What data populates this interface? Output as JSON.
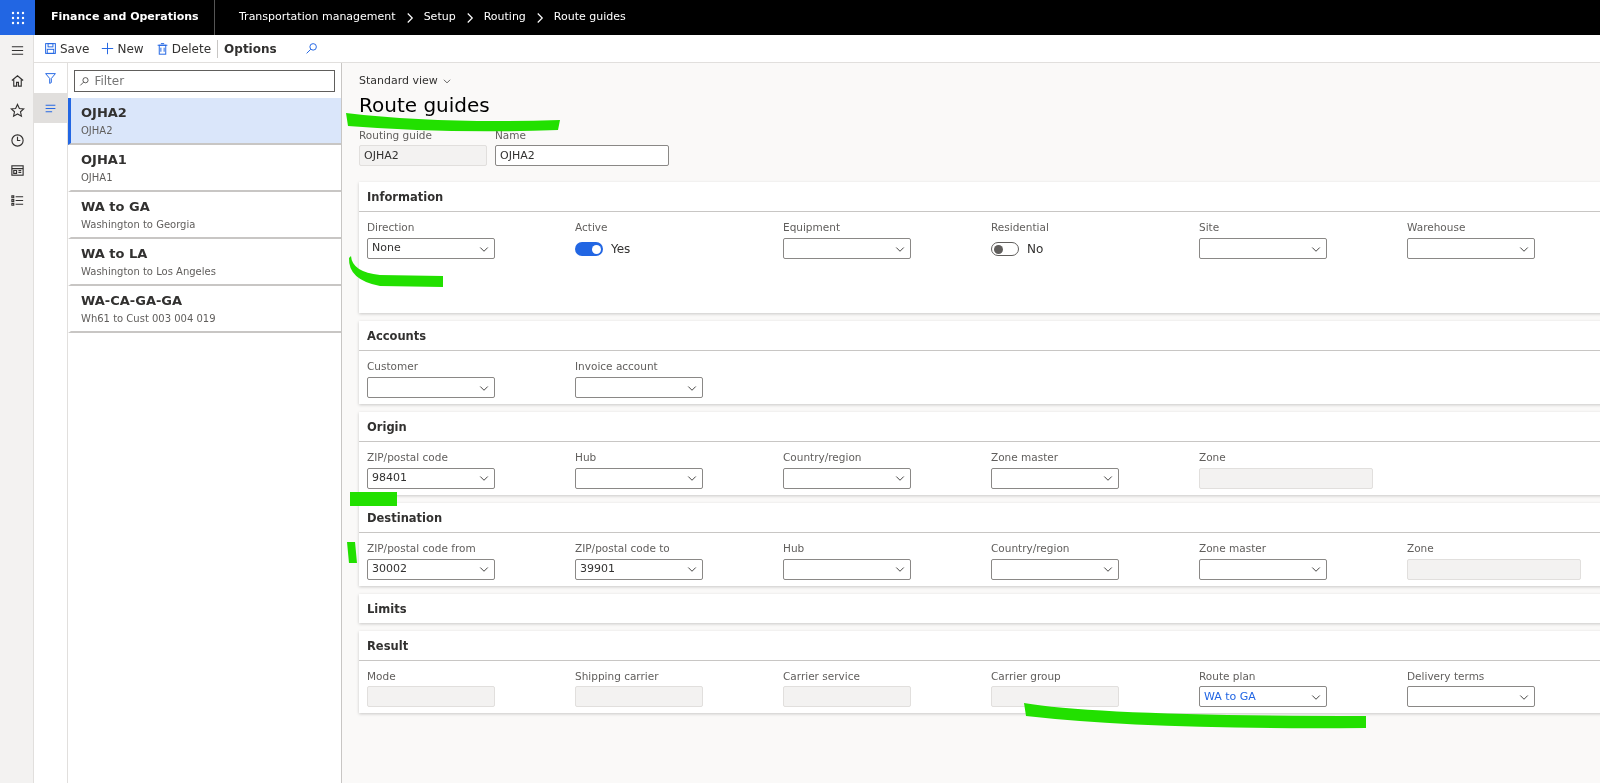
{
  "app_title": "Finance and Operations",
  "breadcrumb": [
    "Transportation management",
    "Setup",
    "Routing",
    "Route guides"
  ],
  "toolbar": [
    {
      "label": "Save",
      "kind": "save"
    },
    {
      "label": "New",
      "kind": "new"
    },
    {
      "label": "Delete",
      "kind": "delete"
    },
    {
      "label": "Options",
      "kind": "text"
    }
  ],
  "list": {
    "filter_placeholder": "Filter",
    "items": [
      {
        "title": "OJHA2",
        "subtitle": "OJHA2",
        "selected": true
      },
      {
        "title": "OJHA1",
        "subtitle": "OJHA1",
        "selected": false
      },
      {
        "title": "WA to GA",
        "subtitle": "Washington to Georgia",
        "selected": false
      },
      {
        "title": "WA to LA",
        "subtitle": "Washington to Los Angeles",
        "selected": false
      },
      {
        "title": "WA-CA-GA-GA",
        "subtitle": "Wh61 to Cust 003 004 019",
        "selected": false
      }
    ]
  },
  "view": "Standard view",
  "page_title": "Route guides",
  "header_fields": [
    {
      "label": "Routing guide",
      "value": "OJHA2",
      "kind": "readonly"
    },
    {
      "label": "Name",
      "value": "OJHA2",
      "kind": "text"
    }
  ],
  "sections": [
    {
      "title": "Information",
      "fields": [
        {
          "label": "Direction",
          "kind": "select",
          "value": "None"
        },
        {
          "label": "Active",
          "kind": "toggle",
          "on": true,
          "value": "Yes"
        },
        {
          "label": "Equipment",
          "kind": "select"
        },
        {
          "label": "Residential",
          "kind": "toggle",
          "on": false,
          "value": "No"
        },
        {
          "label": "Site",
          "kind": "select"
        },
        {
          "label": "Warehouse",
          "kind": "select"
        }
      ]
    },
    {
      "title": "Accounts",
      "fields": [
        {
          "label": "Customer",
          "kind": "select"
        },
        {
          "label": "Invoice account",
          "kind": "select"
        }
      ]
    },
    {
      "title": "Origin",
      "fields": [
        {
          "label": "ZIP/postal code",
          "kind": "select",
          "value": "98401"
        },
        {
          "label": "Hub",
          "kind": "select"
        },
        {
          "label": "Country/region",
          "kind": "select"
        },
        {
          "label": "Zone master",
          "kind": "select"
        },
        {
          "label": "Zone",
          "kind": "readonly",
          "wide": true
        }
      ]
    },
    {
      "title": "Destination",
      "fields": [
        {
          "label": "ZIP/postal code from",
          "kind": "select",
          "value": "30002"
        },
        {
          "label": "ZIP/postal code to",
          "kind": "select",
          "value": "39901"
        },
        {
          "label": "Hub",
          "kind": "select"
        },
        {
          "label": "Country/region",
          "kind": "select"
        },
        {
          "label": "Zone master",
          "kind": "select"
        },
        {
          "label": "Zone",
          "kind": "readonly",
          "wide": true
        }
      ]
    },
    {
      "title": "Limits"
    },
    {
      "title": "Result",
      "fields": [
        {
          "label": "Mode",
          "kind": "readonly"
        },
        {
          "label": "Shipping carrier",
          "kind": "readonly"
        },
        {
          "label": "Carrier service",
          "kind": "readonly"
        },
        {
          "label": "Carrier group",
          "kind": "readonly"
        },
        {
          "label": "Route plan",
          "kind": "link-select",
          "value": "WA to GA"
        },
        {
          "label": "Delivery terms",
          "kind": "select"
        }
      ]
    }
  ]
}
